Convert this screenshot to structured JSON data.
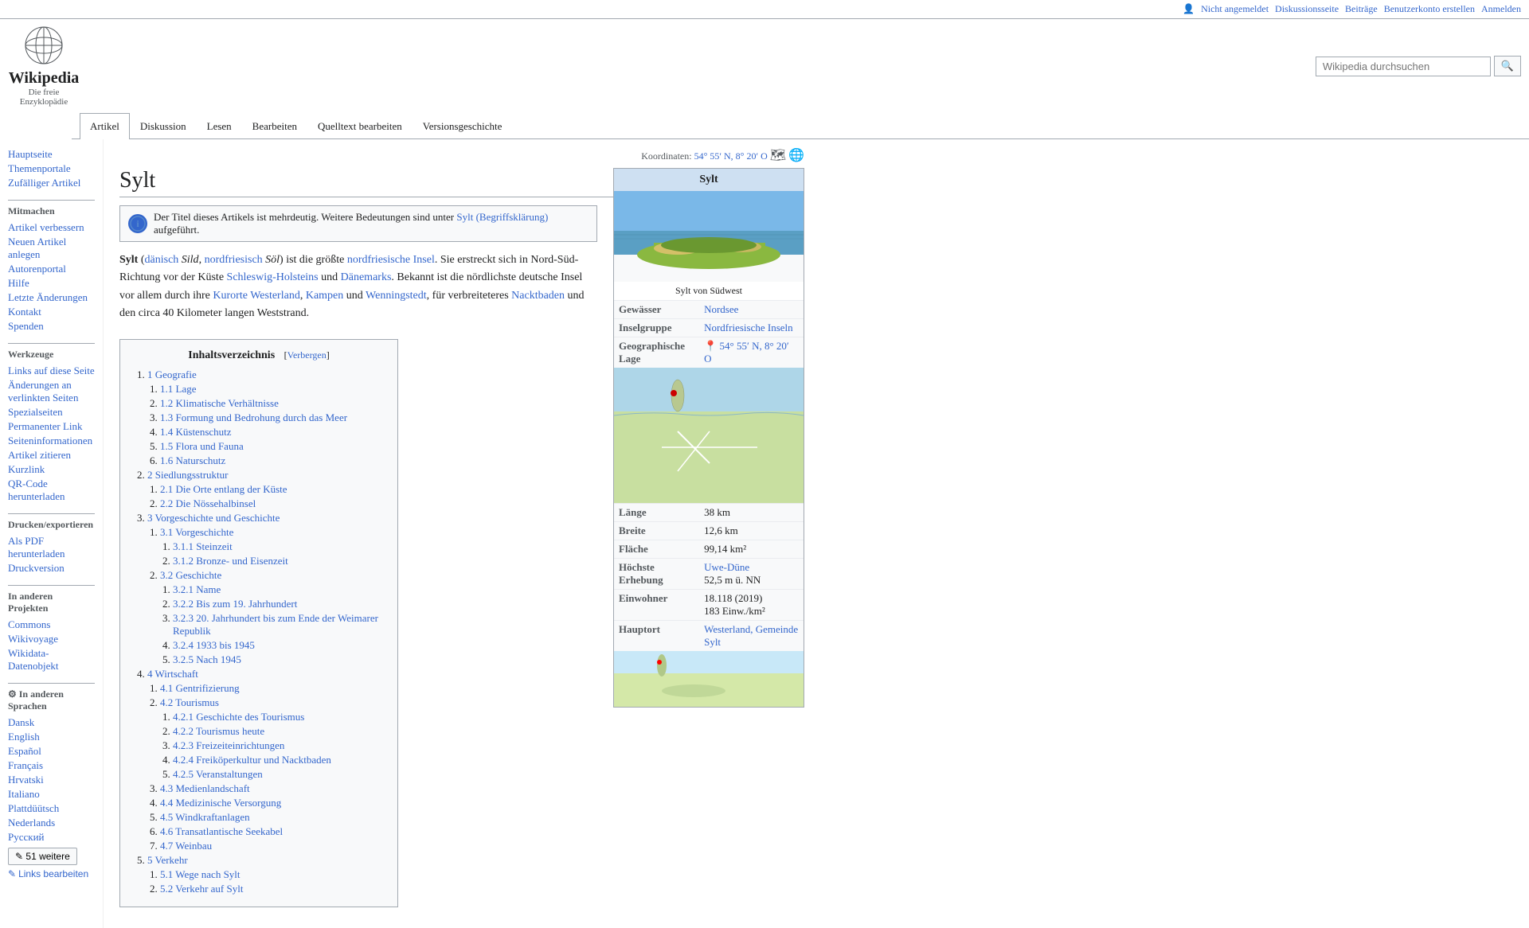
{
  "topbar": {
    "not_logged_in": "Nicht angemeldet",
    "discussion": "Diskussionsseite",
    "contributions": "Beiträge",
    "create_account": "Benutzerkonto erstellen",
    "login": "Anmelden"
  },
  "logo": {
    "title": "Wikipedia",
    "subtitle": "Die freie Enzyklopädie"
  },
  "tabs": [
    {
      "id": "artikel",
      "label": "Artikel",
      "active": true
    },
    {
      "id": "diskussion",
      "label": "Diskussion",
      "active": false
    },
    {
      "id": "lesen",
      "label": "Lesen",
      "active": false
    },
    {
      "id": "bearbeiten",
      "label": "Bearbeiten",
      "active": false
    },
    {
      "id": "quelltext",
      "label": "Quelltext bearbeiten",
      "active": false
    },
    {
      "id": "versionsgeschichte",
      "label": "Versionsgeschichte",
      "active": false
    }
  ],
  "search": {
    "placeholder": "Wikipedia durchsuchen"
  },
  "sidebar": {
    "navigation": {
      "title": "",
      "items": [
        {
          "label": "Hauptseite",
          "href": "#"
        },
        {
          "label": "Themenportale",
          "href": "#"
        },
        {
          "label": "Zufälliger Artikel",
          "href": "#"
        }
      ]
    },
    "mitmachen": {
      "title": "Mitmachen",
      "items": [
        {
          "label": "Artikel verbessern",
          "href": "#"
        },
        {
          "label": "Neuen Artikel anlegen",
          "href": "#"
        },
        {
          "label": "Autorenportal",
          "href": "#"
        },
        {
          "label": "Hilfe",
          "href": "#"
        },
        {
          "label": "Letzte Änderungen",
          "href": "#"
        },
        {
          "label": "Kontakt",
          "href": "#"
        },
        {
          "label": "Spenden",
          "href": "#"
        }
      ]
    },
    "werkzeuge": {
      "title": "Werkzeuge",
      "items": [
        {
          "label": "Links auf diese Seite",
          "href": "#"
        },
        {
          "label": "Änderungen an verlinkten Seiten",
          "href": "#"
        },
        {
          "label": "Spezialseiten",
          "href": "#"
        },
        {
          "label": "Permanenter Link",
          "href": "#"
        },
        {
          "label": "Seiteninformationen",
          "href": "#"
        },
        {
          "label": "Artikel zitieren",
          "href": "#"
        },
        {
          "label": "Kurzlink",
          "href": "#"
        },
        {
          "label": "QR-Code herunterladen",
          "href": "#"
        }
      ]
    },
    "drucken": {
      "title": "Drucken/exportieren",
      "items": [
        {
          "label": "Als PDF herunterladen",
          "href": "#"
        },
        {
          "label": "Druckversion",
          "href": "#"
        }
      ]
    },
    "other_projects": {
      "title": "In anderen Projekten",
      "items": [
        {
          "label": "Commons",
          "href": "#"
        },
        {
          "label": "Wikivoyage",
          "href": "#"
        },
        {
          "label": "Wikidata-Datenobjekt",
          "href": "#"
        }
      ]
    },
    "languages": {
      "title": "In anderen Sprachen",
      "items": [
        {
          "label": "Dansk",
          "href": "#"
        },
        {
          "label": "English",
          "href": "#"
        },
        {
          "label": "Español",
          "href": "#"
        },
        {
          "label": "Français",
          "href": "#"
        },
        {
          "label": "Hrvatski",
          "href": "#"
        },
        {
          "label": "Italiano",
          "href": "#"
        },
        {
          "label": "Plattdüütsch",
          "href": "#"
        },
        {
          "label": "Nederlands",
          "href": "#"
        },
        {
          "label": "Русский",
          "href": "#"
        }
      ],
      "more_label": "51 weitere",
      "links_bearbeiten": "Links bearbeiten"
    }
  },
  "page": {
    "title": "Sylt",
    "coordinates": "54° 55′ N, 8° 20′ O",
    "disambig_notice": "Der Titel dieses Artikels ist mehrdeutig. Weitere Bedeutungen sind unter Sylt (Begriffsklärung) aufgeführt.",
    "intro": "Sylt (dänisch Sild, nordfriesisch Söl) ist die größte nordfriesische Insel. Sie erstreckt sich in Nord-Süd-Richtung vor der Küste Schleswig-Holsteins und Dänemarks. Bekannt ist die nördlichste deutsche Insel vor allem durch ihre Kurorte Westerland, Kampen und Wenningstedt, für verbreiteteres Nacktbaden und den circa 40 Kilometer langen Weststrand."
  },
  "toc": {
    "title": "Inhaltsverzeichnis",
    "toggle_label": "Verbergen",
    "sections": [
      {
        "num": "1",
        "label": "Geografie",
        "subsections": [
          {
            "num": "1.1",
            "label": "Lage"
          },
          {
            "num": "1.2",
            "label": "Klimatische Verhältnisse"
          },
          {
            "num": "1.3",
            "label": "Formung und Bedrohung durch das Meer"
          },
          {
            "num": "1.4",
            "label": "Küstenschutz"
          },
          {
            "num": "1.5",
            "label": "Flora und Fauna"
          },
          {
            "num": "1.6",
            "label": "Naturschutz"
          }
        ]
      },
      {
        "num": "2",
        "label": "Siedlungsstruktur",
        "subsections": [
          {
            "num": "2.1",
            "label": "Die Orte entlang der Küste"
          },
          {
            "num": "2.2",
            "label": "Die Nössehalbinsel"
          }
        ]
      },
      {
        "num": "3",
        "label": "Vorgeschichte und Geschichte",
        "subsections": [
          {
            "num": "3.1",
            "label": "Vorgeschichte",
            "sub2": [
              {
                "num": "3.1.1",
                "label": "Steinzeit"
              },
              {
                "num": "3.1.2",
                "label": "Bronze- und Eisenzeit"
              }
            ]
          },
          {
            "num": "3.2",
            "label": "Geschichte",
            "sub2": [
              {
                "num": "3.2.1",
                "label": "Name"
              },
              {
                "num": "3.2.2",
                "label": "Bis zum 19. Jahrhundert"
              },
              {
                "num": "3.2.3",
                "label": "20. Jahrhundert bis zum Ende der Weimarer Republik"
              },
              {
                "num": "3.2.4",
                "label": "1933 bis 1945"
              },
              {
                "num": "3.2.5",
                "label": "Nach 1945"
              }
            ]
          }
        ]
      },
      {
        "num": "4",
        "label": "Wirtschaft",
        "subsections": [
          {
            "num": "4.1",
            "label": "Gentrifizierung"
          },
          {
            "num": "4.2",
            "label": "Tourismus",
            "sub2": [
              {
                "num": "4.2.1",
                "label": "Geschichte des Tourismus"
              },
              {
                "num": "4.2.2",
                "label": "Tourismus heute"
              },
              {
                "num": "4.2.3",
                "label": "Freizeiteinrichtungen"
              },
              {
                "num": "4.2.4",
                "label": "Freiköperkultur und Nacktbaden"
              },
              {
                "num": "4.2.5",
                "label": "Veranstaltungen"
              }
            ]
          },
          {
            "num": "4.3",
            "label": "Medienlandschaft"
          },
          {
            "num": "4.4",
            "label": "Medizinische Versorgung"
          },
          {
            "num": "4.5",
            "label": "Windkraftanlagen"
          },
          {
            "num": "4.6",
            "label": "Transatlantische Seekabel"
          },
          {
            "num": "4.7",
            "label": "Weinbau"
          }
        ]
      },
      {
        "num": "5",
        "label": "Verkehr",
        "subsections": [
          {
            "num": "5.1",
            "label": "Wege nach Sylt"
          },
          {
            "num": "5.2",
            "label": "Verkehr auf Sylt"
          }
        ]
      }
    ]
  },
  "infobox": {
    "title": "Sylt",
    "caption": "Sylt von Südwest",
    "rows": [
      {
        "label": "Gewässer",
        "value": "Nordsee"
      },
      {
        "label": "Inselgruppe",
        "value": "Nordfriesische Inseln"
      },
      {
        "label": "Geographische Lage",
        "value": "54° 55′ N, 8° 20′ O"
      },
      {
        "label": "Länge",
        "value": "38 km"
      },
      {
        "label": "Breite",
        "value": "12,6 km"
      },
      {
        "label": "Fläche",
        "value": "99,14 km²"
      },
      {
        "label": "Höchste Erhebung",
        "value": "Uwe-Düne\n52,5 m ü. NN"
      },
      {
        "label": "Einwohner",
        "value": "18.118 (2019)\n183 Einw./km²"
      },
      {
        "label": "Hauptort",
        "value": "Westerland, Gemeinde Sylt"
      }
    ]
  }
}
